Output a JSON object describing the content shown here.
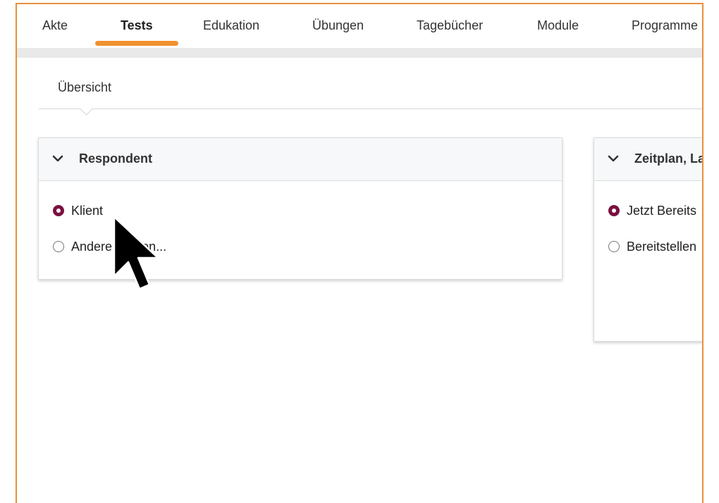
{
  "tabs": [
    {
      "label": "Akte"
    },
    {
      "label": "Tests",
      "active": true
    },
    {
      "label": "Edukation"
    },
    {
      "label": "Übungen"
    },
    {
      "label": "Tagebücher"
    },
    {
      "label": "Module"
    },
    {
      "label": "Programme"
    }
  ],
  "subnav": {
    "label": "Übersicht"
  },
  "respondent_panel": {
    "title": "Respondent",
    "options": [
      {
        "label": "Klient",
        "selected": true
      },
      {
        "label": "Andere Person...",
        "selected": false
      }
    ]
  },
  "schedule_panel": {
    "title": "Zeitplan, La",
    "options": [
      {
        "label": "Jetzt Bereits",
        "selected": true
      },
      {
        "label": "Bereitstellen",
        "selected": false
      }
    ]
  },
  "colors": {
    "frame_border": "#e8913a",
    "tab_underline": "#f0922e",
    "radio_selected": "#7a1040"
  }
}
